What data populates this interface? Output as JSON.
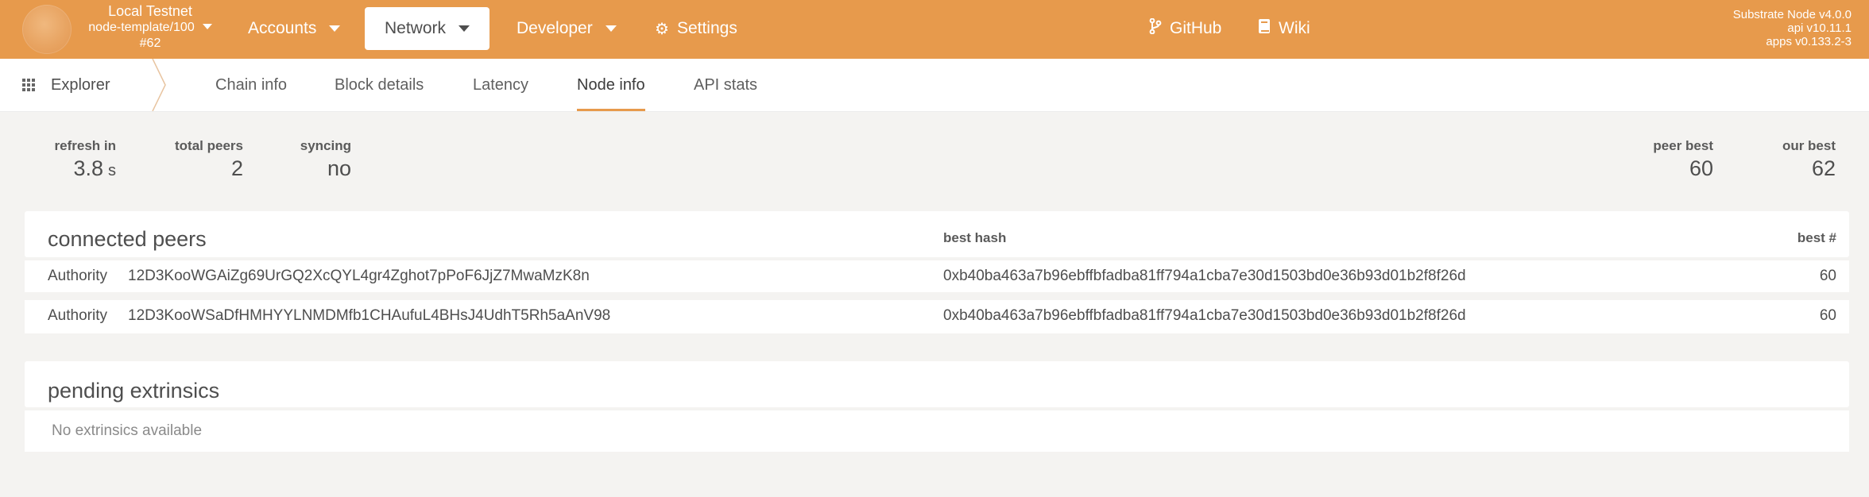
{
  "topbar": {
    "chain_name": "Local Testnet",
    "node_name": "node-template/100",
    "block": "#62",
    "menu": {
      "accounts": "Accounts",
      "network": "Network",
      "developer": "Developer",
      "settings": "Settings",
      "github": "GitHub",
      "wiki": "Wiki"
    },
    "version": {
      "node": "Substrate Node v4.0.0",
      "api": "api v10.11.1",
      "apps": "apps v0.133.2-3"
    }
  },
  "subnav": {
    "section": "Explorer",
    "tabs": [
      "Chain info",
      "Block details",
      "Latency",
      "Node info",
      "API stats"
    ],
    "active_tab": "Node info"
  },
  "stats": {
    "refresh_label": "refresh in",
    "refresh_value": "3.8",
    "refresh_unit": "s",
    "peers_label": "total peers",
    "peers_value": "2",
    "syncing_label": "syncing",
    "syncing_value": "no",
    "peer_best_label": "peer best",
    "peer_best_value": "60",
    "our_best_label": "our best",
    "our_best_value": "62"
  },
  "peers": {
    "title": "connected peers",
    "col_hash": "best hash",
    "col_best": "best #",
    "rows": [
      {
        "role": "Authority",
        "peer_id": "12D3KooWGAiZg69UrGQ2XcQYL4gr4Zghot7pPoF6JjZ7MwaMzK8n",
        "hash": "0xb40ba463a7b96ebffbfadba81ff794a1cba7e30d1503bd0e36b93d01b2f8f26d",
        "best": "60"
      },
      {
        "role": "Authority",
        "peer_id": "12D3KooWSaDfHMHYYLNMDMfb1CHAufuL4BHsJ4UdhT5Rh5aAnV98",
        "hash": "0xb40ba463a7b96ebffbfadba81ff794a1cba7e30d1503bd0e36b93d01b2f8f26d",
        "best": "60"
      }
    ]
  },
  "extrinsics": {
    "title": "pending extrinsics",
    "empty": "No extrinsics available"
  },
  "colors": {
    "accent": "#e79a4c",
    "background": "#f4f3f1"
  }
}
